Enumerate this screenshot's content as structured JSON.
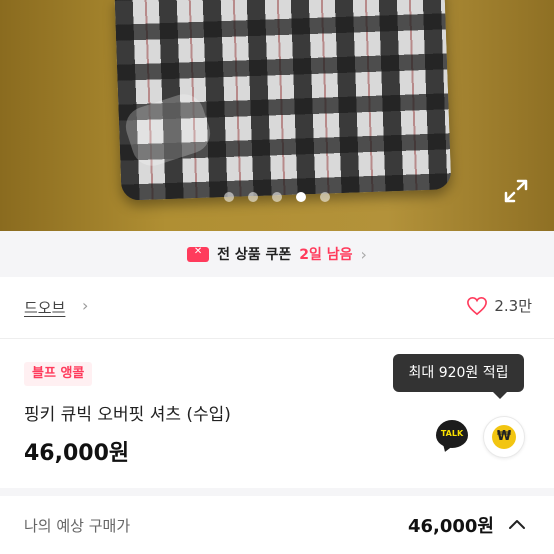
{
  "gallery": {
    "page_count": 5,
    "active_index": 3,
    "expand_icon": "expand-icon"
  },
  "coupon_bar": {
    "prefix": "전 상품 쿠폰",
    "highlight": "2일 남음",
    "chevron": "›",
    "accent_color": "#ff3b5c"
  },
  "store": {
    "name": "드오브",
    "chevron": "›",
    "like_count": "2.3만"
  },
  "product": {
    "badge": "블프 앵콜",
    "title": "핑키 큐빅 오버핏 셔츠 (수입)",
    "price": "46,000원"
  },
  "reward_tooltip": "최대 920원 적립",
  "talk_label": "TALK",
  "won_symbol": "₩",
  "estimate": {
    "label": "나의 예상 구매가",
    "price": "46,000원"
  }
}
